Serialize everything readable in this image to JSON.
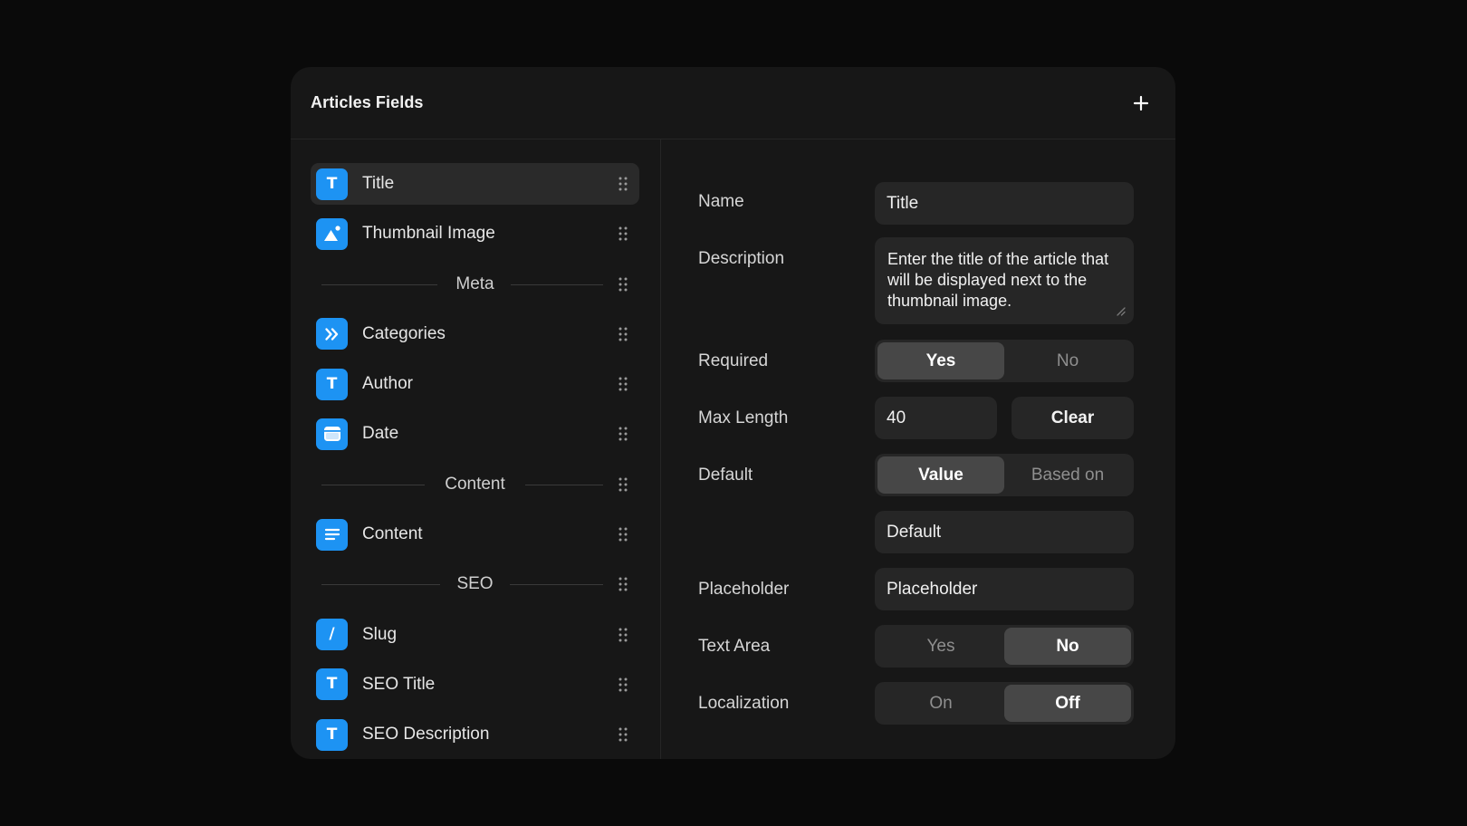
{
  "panel": {
    "title": "Articles Fields"
  },
  "fields": {
    "title": {
      "label": "Title",
      "icon": "text-icon",
      "glyph": "T"
    },
    "thumbnail": {
      "label": "Thumbnail Image",
      "icon": "image-icon"
    },
    "meta_group": {
      "label": "Meta"
    },
    "categories": {
      "label": "Categories",
      "icon": "reference-icon"
    },
    "author": {
      "label": "Author",
      "icon": "text-icon",
      "glyph": "T"
    },
    "date": {
      "label": "Date",
      "icon": "calendar-icon"
    },
    "content_group": {
      "label": "Content"
    },
    "content": {
      "label": "Content",
      "icon": "rich-text-icon"
    },
    "seo_group": {
      "label": "SEO"
    },
    "slug": {
      "label": "Slug",
      "icon": "slug-icon",
      "glyph": "/"
    },
    "seo_title": {
      "label": "SEO Title",
      "icon": "text-icon",
      "glyph": "T"
    },
    "seo_description": {
      "label": "SEO Description",
      "icon": "text-icon",
      "glyph": "T"
    }
  },
  "properties": {
    "name": {
      "label": "Name",
      "value": "Title"
    },
    "description": {
      "label": "Description",
      "value": "Enter the title of the article that will be displayed next to the thumbnail image."
    },
    "required": {
      "label": "Required",
      "options": [
        "Yes",
        "No"
      ],
      "selected": "Yes"
    },
    "max_length": {
      "label": "Max Length",
      "value": "40",
      "clear_label": "Clear"
    },
    "default": {
      "label": "Default",
      "options": [
        "Value",
        "Based on"
      ],
      "selected": "Value",
      "value": "Default"
    },
    "placeholder": {
      "label": "Placeholder",
      "value": "Placeholder"
    },
    "text_area": {
      "label": "Text Area",
      "options": [
        "Yes",
        "No"
      ],
      "selected": "No"
    },
    "localization": {
      "label": "Localization",
      "options": [
        "On",
        "Off"
      ],
      "selected": "Off"
    }
  },
  "colors": {
    "background": "#0a0a0a",
    "panel": "#171717",
    "input": "#262626",
    "accent": "#1d93f3",
    "segment_active": "#474747"
  }
}
